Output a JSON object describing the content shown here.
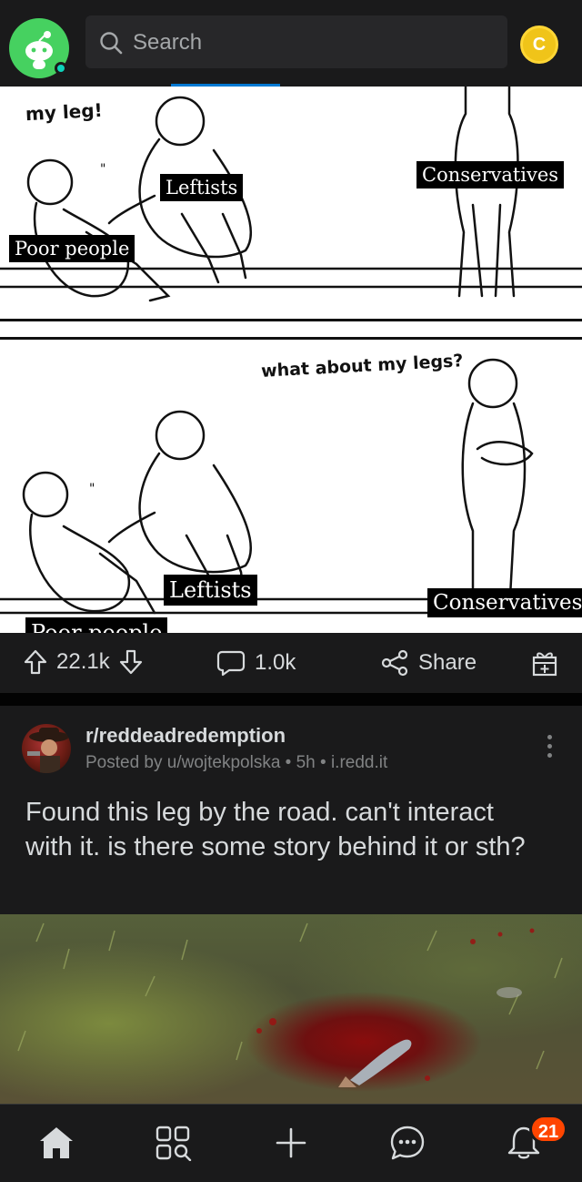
{
  "header": {
    "search_placeholder": "Search",
    "coin_symbol": "C"
  },
  "meme": {
    "panel1": {
      "caption": "my leg!",
      "labels": {
        "poor": "Poor people",
        "leftists": "Leftists",
        "conservatives": "Conservatives"
      }
    },
    "panel2": {
      "caption": "what about my legs?",
      "labels": {
        "poor": "Poor people",
        "leftists": "Leftists",
        "conservatives": "Conservatives"
      }
    }
  },
  "actions": {
    "upvotes": "22.1k",
    "comments": "1.0k",
    "share": "Share"
  },
  "post": {
    "subreddit": "r/reddeadredemption",
    "meta": "Posted by u/wojtekpolska • 5h • i.redd.it",
    "title": "Found this leg by the road. can't interact with it. is there some story behind it or sth?"
  },
  "bottom_nav": {
    "items": [
      "home-icon",
      "discover-icon",
      "create-icon",
      "chat-icon",
      "inbox-icon"
    ],
    "inbox_badge": "21"
  },
  "colors": {
    "background": "#030303",
    "surface": "#1a1a1b",
    "text": "#d7dadc",
    "muted": "#818384",
    "accent_orange": "#ff4500",
    "accent_blue": "#0079d3",
    "avatar_green": "#46d160",
    "coin_gold": "#f0c419"
  }
}
